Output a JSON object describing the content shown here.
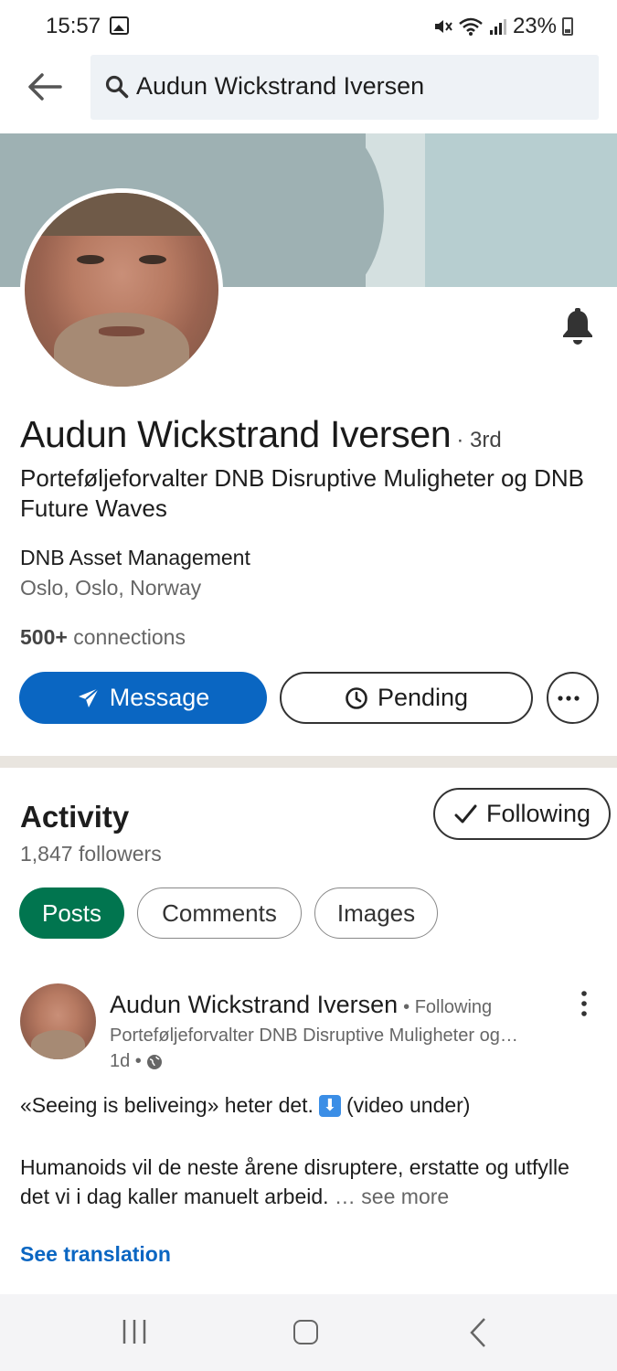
{
  "status_bar": {
    "time": "15:57",
    "battery": "23%"
  },
  "search": {
    "query": "Audun Wickstrand Iversen"
  },
  "profile": {
    "name": "Audun Wickstrand Iversen",
    "degree": "· 3rd",
    "headline": "Porteføljeforvalter DNB Disruptive Muligheter og DNB Future Waves",
    "company": "DNB Asset Management",
    "location": "Oslo, Oslo, Norway",
    "connections_count": "500+",
    "connections_label": " connections"
  },
  "actions": {
    "message": "Message",
    "pending": "Pending"
  },
  "activity": {
    "title": "Activity",
    "followers": "1,847 followers",
    "following_button": "Following",
    "tabs": [
      {
        "label": "Posts",
        "active": true
      },
      {
        "label": "Comments",
        "active": false
      },
      {
        "label": "Images",
        "active": false
      }
    ]
  },
  "post": {
    "author": "Audun Wickstrand Iversen",
    "author_status": "• Following",
    "author_headline": "Porteføljeforvalter DNB Disruptive Muligheter og…",
    "age": "1d •",
    "line1_before": "«Seeing is beliveing» heter det.",
    "line1_after": "(video under)",
    "body": "Humanoids vil de neste årene disruptere, erstatte og utfylle det vi i dag kaller manuelt arbeid.",
    "see_more": " … see more",
    "see_translation": "See translation"
  },
  "colors": {
    "primary_blue": "#0a66c2",
    "posts_green": "#01754f",
    "banner": "#9eb1b3"
  }
}
